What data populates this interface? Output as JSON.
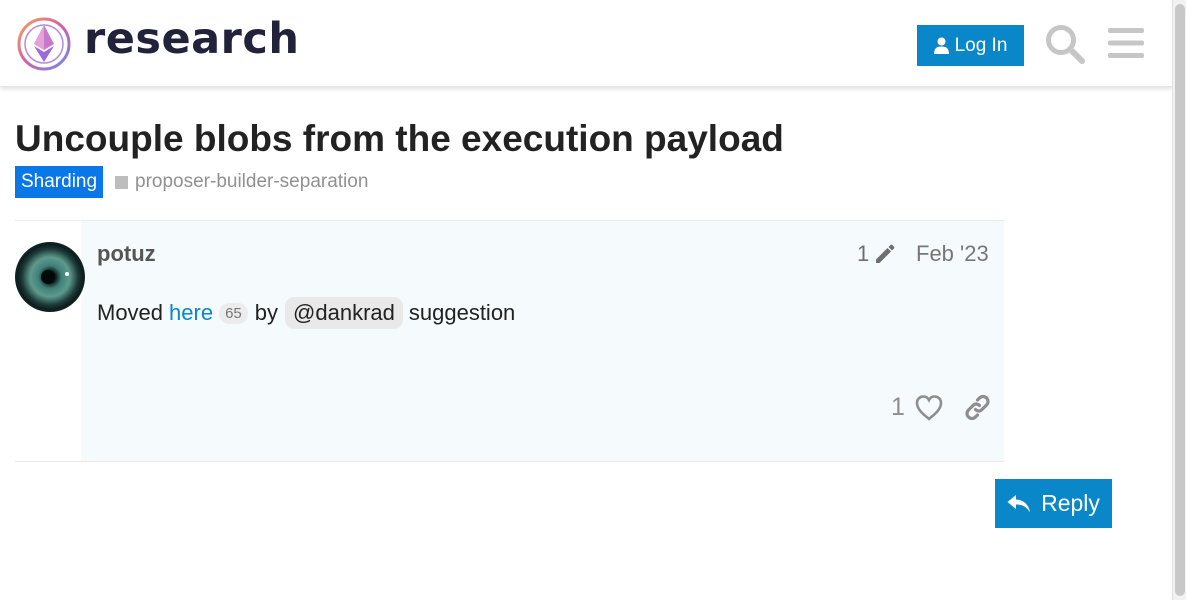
{
  "header": {
    "logo_text": "research",
    "login_label": "Log In",
    "icons": {
      "logo": "ethereum-research-logo",
      "user": "user-icon",
      "search": "search-icon",
      "menu": "hamburger-menu-icon"
    }
  },
  "topic": {
    "title": "Uncouple blobs from the execution payload",
    "category": "Sharding",
    "tag": "proposer-builder-separation"
  },
  "post": {
    "username": "potuz",
    "edit_count": "1",
    "date": "Feb '23",
    "text_before": "Moved",
    "link_text": "here",
    "link_clicks": "65",
    "by": "by",
    "mention": "@dankrad",
    "text_after": "suggestion",
    "like_count": "1"
  },
  "actions": {
    "reply_label": "Reply"
  },
  "colors": {
    "accent": "#0a87c8",
    "category": "#0a77e8",
    "post_bg": "#f5fafd"
  }
}
